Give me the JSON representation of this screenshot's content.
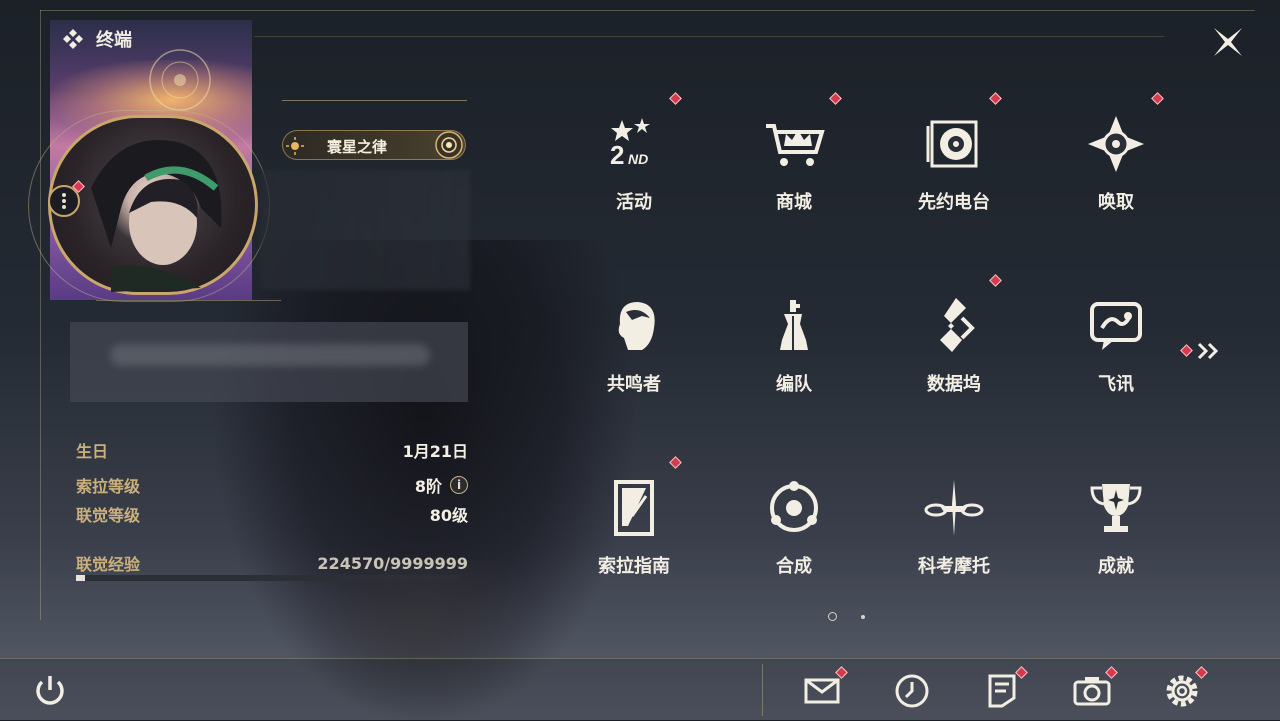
{
  "header": {
    "title": "终端",
    "title_icon": "diamond-cluster-icon",
    "close_icon": "close-icon"
  },
  "profile": {
    "avatar_icon": "character-portrait",
    "title_badge": "寰星之律",
    "rows": [
      {
        "key": "生日",
        "value": "1月21日"
      },
      {
        "key": "索拉等级",
        "value": "8阶"
      },
      {
        "key": "联觉等级",
        "value": "80级"
      },
      {
        "key": "联觉经验",
        "value": "224570/9999999"
      }
    ],
    "exp_progress": 0.0225
  },
  "menu": {
    "items": [
      {
        "label": "活动",
        "icon": "event-2nd-anniversary-icon",
        "badge": true
      },
      {
        "label": "商城",
        "icon": "shop-cart-crown-icon",
        "badge": true
      },
      {
        "label": "先约电台",
        "icon": "radio-vinyl-icon",
        "badge": true
      },
      {
        "label": "唤取",
        "icon": "compass-star-icon",
        "badge": true
      },
      {
        "label": "共鸣者",
        "icon": "resonator-head-icon",
        "badge": false
      },
      {
        "label": "编队",
        "icon": "chess-team-icon",
        "badge": false
      },
      {
        "label": "数据坞",
        "icon": "data-bank-icon",
        "badge": true
      },
      {
        "label": "飞讯",
        "icon": "chat-message-icon",
        "badge": false
      },
      {
        "label": "索拉指南",
        "icon": "guide-book-icon",
        "badge": true
      },
      {
        "label": "合成",
        "icon": "synthesis-orbit-icon",
        "badge": false
      },
      {
        "label": "科考摩托",
        "icon": "motorbike-icon",
        "badge": false
      },
      {
        "label": "成就",
        "icon": "trophy-icon",
        "badge": false
      }
    ],
    "next_page_icon": "chevron-double-right-icon",
    "page_current": 1,
    "page_total": 2
  },
  "bottom_bar": {
    "power_icon": "power-icon",
    "buttons": [
      {
        "name": "mail",
        "icon": "mail-icon"
      },
      {
        "name": "clock",
        "icon": "clock-icon"
      },
      {
        "name": "notice",
        "icon": "notice-doc-icon"
      },
      {
        "name": "camera",
        "icon": "camera-icon"
      },
      {
        "name": "settings",
        "icon": "gear-icon"
      }
    ]
  },
  "colors": {
    "accent": "#c9a66b",
    "badge_red": "#d9394e",
    "text": "#f2eee4"
  }
}
